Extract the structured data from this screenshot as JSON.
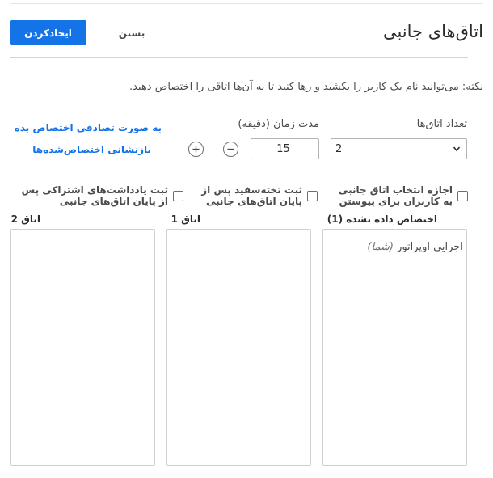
{
  "header": {
    "title": "اتاق‌های جانبی",
    "create_label": "ایجادکردن",
    "close_label": "بستن"
  },
  "note": "نکته: می‌توانید نام یک کاربر را بکشید و رها کنید تا به آن‌ها اتاقی را اختصاص دهید.",
  "controls": {
    "rooms_label": "تعداد اتاق‌ها",
    "rooms_value": "2",
    "duration_label": "مدت زمان (دقیقه)",
    "duration_value": "15",
    "random_assign_label": "به صورت تصادفی اختصاص بده",
    "reset_assign_label": "بازنشانی اختصاص‌شده‌ها"
  },
  "options": [
    {
      "label": "اجازه انتخاب اتاق جانبی به کاربران برای پیوستن",
      "checked": false
    },
    {
      "label": "ثبت تخته‌سفید پس از پایان اتاق‌های جانبی",
      "checked": false
    },
    {
      "label": "ثبت یادداشت‌های اشتراکی پس از پایان اتاق‌های جانبی",
      "checked": false
    }
  ],
  "columns": [
    {
      "title": "اختصاص داده نشده (1)",
      "participants": [
        {
          "name": "اجرایی اوپراتور",
          "suffix": "(شما)"
        }
      ]
    },
    {
      "title": "اتاق 1",
      "participants": []
    },
    {
      "title": "اتاق 2",
      "participants": []
    }
  ],
  "icons": {
    "select_chevron": "chevron-down-icon",
    "decrement": "minus-circle-icon",
    "increment": "plus-circle-icon"
  },
  "colors": {
    "accent": "#1473e6",
    "text": "#2c2c2c",
    "muted": "#4b4b4b",
    "border": "#b3b3b3"
  }
}
